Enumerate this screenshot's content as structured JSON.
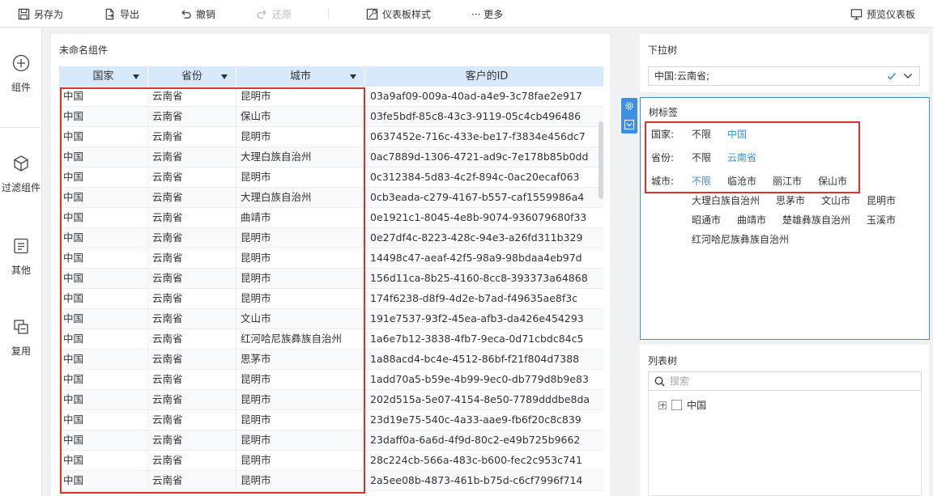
{
  "toolbar": {
    "save_as": "另存为",
    "export": "导出",
    "undo": "撤销",
    "redo": "还原",
    "dashboard_style": "仪表板样式",
    "more": "··· 更多",
    "preview": "预览仪表板"
  },
  "sidebar": {
    "items": [
      {
        "label": "组件",
        "icon": "plus-circle-icon"
      },
      {
        "label": "过滤组件",
        "icon": "cube-icon"
      },
      {
        "label": "其他",
        "icon": "document-icon"
      },
      {
        "label": "复用",
        "icon": "copy-icon"
      }
    ]
  },
  "table_widget": {
    "title": "未命名组件",
    "columns": [
      "国家",
      "省份",
      "城市",
      "客户的ID"
    ],
    "rows": [
      [
        "中国",
        "云南省",
        "昆明市",
        "03a9af09-009a-40ad-a4e9-3c78fae2e917"
      ],
      [
        "中国",
        "云南省",
        "保山市",
        "03fe5bdf-85c8-43c3-9119-05c4cb496486"
      ],
      [
        "中国",
        "云南省",
        "昆明市",
        "0637452e-716c-433e-be17-f3834e456dc7"
      ],
      [
        "中国",
        "云南省",
        "大理白族自治州",
        "0ac7889d-1306-4721-ad9c-7e178b85b0dd"
      ],
      [
        "中国",
        "云南省",
        "昆明市",
        "0c312384-5d83-4c2f-894c-0ac20ecaf063"
      ],
      [
        "中国",
        "云南省",
        "大理白族自治州",
        "0cb3eada-c279-4167-b557-caf1559986a4"
      ],
      [
        "中国",
        "云南省",
        "曲靖市",
        "0e1921c1-8045-4e8b-9074-936079680f33"
      ],
      [
        "中国",
        "云南省",
        "昆明市",
        "0e27df4c-8223-428c-94e3-a26fd311b329"
      ],
      [
        "中国",
        "云南省",
        "昆明市",
        "14498c47-aeaf-42f5-98a9-98bdaa4eb97d"
      ],
      [
        "中国",
        "云南省",
        "昆明市",
        "156d11ca-8b25-4160-8cc8-393373a64868"
      ],
      [
        "中国",
        "云南省",
        "昆明市",
        "174f6238-d8f9-4d2e-b7ad-f49635ae8f3c"
      ],
      [
        "中国",
        "云南省",
        "文山市",
        "191e7537-93f2-45ea-afb3-da426e454293"
      ],
      [
        "中国",
        "云南省",
        "红河哈尼族彝族自治州",
        "1a6e7b12-3838-4fb7-9eca-0d71cbdc84c5"
      ],
      [
        "中国",
        "云南省",
        "思茅市",
        "1a88acd4-bc4e-4512-86bf-f21f804d7388"
      ],
      [
        "中国",
        "云南省",
        "昆明市",
        "1add70a5-b59e-4b99-9ec0-db779d8b9e83"
      ],
      [
        "中国",
        "云南省",
        "昆明市",
        "202d515a-5e07-4154-8e50-7789dddbe8da"
      ],
      [
        "中国",
        "云南省",
        "昆明市",
        "23d19e75-540c-4a33-aae9-fb6f20c8c839"
      ],
      [
        "中国",
        "云南省",
        "昆明市",
        "23daff0a-6a6d-4f9d-80c2-e49b725b9662"
      ],
      [
        "中国",
        "云南省",
        "昆明市",
        "28c224cb-566a-483c-b600-fec2c953c741"
      ],
      [
        "中国",
        "云南省",
        "昆明市",
        "2a5ee08b-4873-461b-b75d-c6cf7996f714"
      ]
    ]
  },
  "dropdown_tree": {
    "label": "下拉树",
    "value": "中国:云南省;"
  },
  "tree_label": {
    "label": "树标签",
    "rows": [
      {
        "name": "国家:",
        "options": [
          "不限",
          "中国"
        ],
        "active": 1
      },
      {
        "name": "省份:",
        "options": [
          "不限",
          "云南省"
        ],
        "active": 1
      },
      {
        "name": "城市:",
        "options": [
          "不限",
          "临沧市",
          "丽江市",
          "保山市"
        ],
        "active": 0
      }
    ],
    "more_cities": [
      [
        "大理白族自治州",
        "思茅市",
        "文山市",
        "昆明市"
      ],
      [
        "昭通市",
        "曲靖市",
        "楚雄彝族自治州",
        "玉溪市"
      ],
      [
        "红河哈尼族彝族自治州"
      ]
    ]
  },
  "list_tree": {
    "label": "列表树",
    "search_placeholder": "搜索",
    "node": "中国"
  },
  "colors": {
    "accent": "#3d8fe3",
    "highlight": "#e0302a",
    "header_bg": "#d7e9fb"
  }
}
